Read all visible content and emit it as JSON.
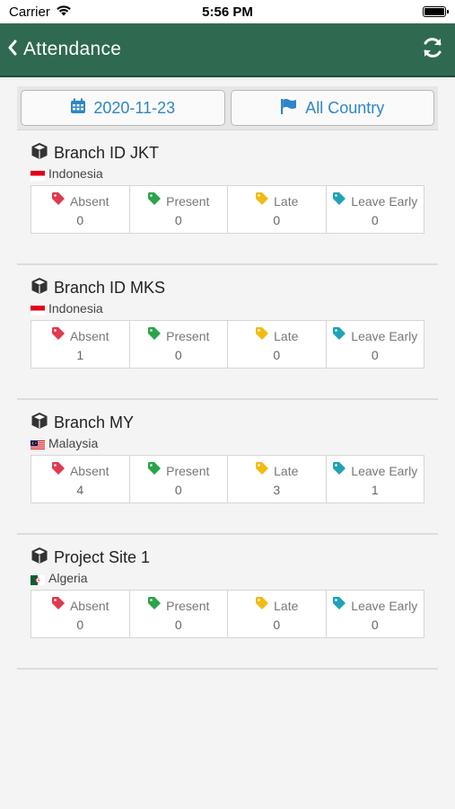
{
  "status_bar": {
    "carrier": "Carrier",
    "time": "5:56 PM"
  },
  "header": {
    "title": "Attendance"
  },
  "filters": {
    "date": "2020-11-23",
    "country": "All Country"
  },
  "colors": {
    "header_bg": "#2f6a50",
    "accent": "#2e86c9",
    "absent": "#e03a4e",
    "present": "#2aa44a",
    "late": "#f2bb14",
    "leave_early": "#20a3b7"
  },
  "stat_labels": {
    "absent": "Absent",
    "present": "Present",
    "late": "Late",
    "leave_early": "Leave Early"
  },
  "branches": [
    {
      "name": "Branch ID JKT",
      "country": "Indonesia",
      "flag": "indonesia-flag",
      "absent": "0",
      "present": "0",
      "late": "0",
      "leave_early": "0"
    },
    {
      "name": "Branch ID MKS",
      "country": "Indonesia",
      "flag": "indonesia-flag",
      "absent": "1",
      "present": "0",
      "late": "0",
      "leave_early": "0"
    },
    {
      "name": "Branch MY",
      "country": "Malaysia",
      "flag": "malaysia-flag",
      "absent": "4",
      "present": "0",
      "late": "3",
      "leave_early": "1"
    },
    {
      "name": "Project Site 1",
      "country": "Algeria",
      "flag": "algeria-flag",
      "absent": "0",
      "present": "0",
      "late": "0",
      "leave_early": "0"
    }
  ]
}
